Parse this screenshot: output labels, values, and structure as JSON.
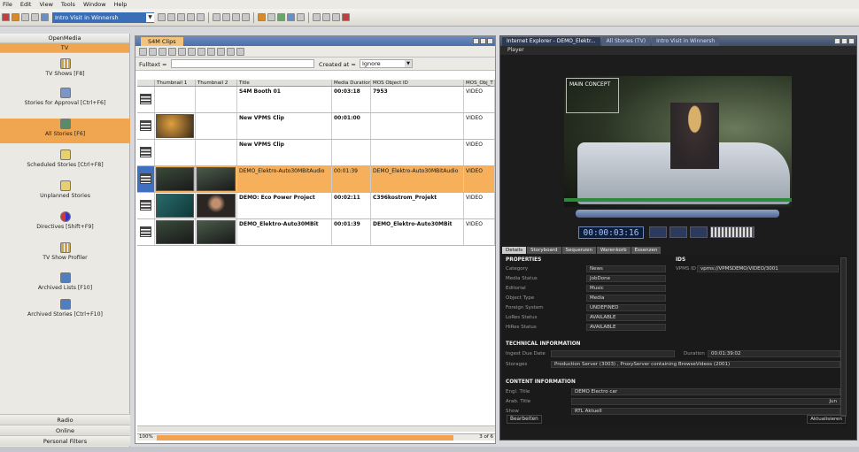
{
  "menubar": {
    "items": [
      "File",
      "Edit",
      "View",
      "Tools",
      "Window",
      "Help"
    ]
  },
  "toolbar": {
    "window_select": "Intro Visit in Winnersh"
  },
  "sidebar": {
    "header": "OpenMedia",
    "section": "TV",
    "items": [
      {
        "label": "TV Shows [F8]",
        "icon": "grid-icon"
      },
      {
        "label": "Stories for Approval [Ctrl+F6]",
        "icon": "story-icon"
      },
      {
        "label": "All Stories [F6]",
        "icon": "stories-icon",
        "selected": true
      },
      {
        "label": "Scheduled Stories [Ctrl+F8]",
        "icon": "scheduled-icon"
      },
      {
        "label": "Unplanned Stories",
        "icon": "unplanned-icon"
      },
      {
        "label": "Directives [Shift+F9]",
        "icon": "directives-icon"
      },
      {
        "label": "TV Show Profiler",
        "icon": "profiler-icon"
      },
      {
        "label": "Archived Lists [F10]",
        "icon": "archive-icon"
      },
      {
        "label": "Archived Stories [Ctrl+F10]",
        "icon": "archive-icon"
      }
    ],
    "footer": [
      "Radio",
      "Online",
      "Personal Filters"
    ]
  },
  "clips": {
    "tab": "S4M Clips",
    "fulltext_label": "Fulltext =",
    "created_label": "Created at =",
    "created_value": "Ignore",
    "columns": [
      "Thumbnail 1",
      "Thumbnail 2",
      "Title",
      "Media Duration",
      "MOS Object ID",
      "MOS_Obj_T"
    ],
    "rows": [
      {
        "title": "S4M Booth 01",
        "duration": "00:03:18",
        "mos_id": "7953",
        "type": "VIDEO",
        "thumbs": 0
      },
      {
        "title": "New VPMS Clip",
        "duration": "00:01:00",
        "mos_id": "",
        "type": "VIDEO",
        "thumbs": 1
      },
      {
        "title": "New VPMS Clip",
        "duration": "",
        "mos_id": "",
        "type": "VIDEO",
        "thumbs": 0
      },
      {
        "title": "DEMO_Elektro-Auto30MBitAudio",
        "duration": "00:01:39",
        "mos_id": "DEMO_Elektro-Auto30MBitAudio",
        "type": "VIDEO",
        "thumbs": 2,
        "selected": true
      },
      {
        "title": "DEMO: Eco Power Project",
        "duration": "00:02:11",
        "mos_id": "C396kostrom_Projekt",
        "type": "VIDEO",
        "thumbs": 2
      },
      {
        "title": "DEMO_Elektro-Auto30MBit",
        "duration": "00:01:39",
        "mos_id": "DEMO_Elektro-Auto30MBit",
        "type": "VIDEO",
        "thumbs": 2
      }
    ],
    "status_pct": "100%",
    "status_count": "3 of 6"
  },
  "right": {
    "tabs": [
      "Internet Explorer - DEMO_Elektr...",
      "All Stories (TV)",
      "Intro Visit in Winnersh"
    ],
    "player_title": "Player",
    "video_logo": "MAIN CONCEPT",
    "timecode": "00:00:03:16",
    "detail_tabs": [
      "Details",
      "Storyboard",
      "Sequenzen",
      "Warenkorb",
      "Essenzen"
    ],
    "properties_header": "PROPERTIES",
    "ids_header": "IDS",
    "vpms_id_label": "VPMS ID",
    "vpms_id_value": "vpms://VPMSDEMO/VIDEO/3001",
    "properties": [
      {
        "label": "Category",
        "value": "News"
      },
      {
        "label": "Media Status",
        "value": "JobDone"
      },
      {
        "label": "Editorial",
        "value": "Music"
      },
      {
        "label": "Object Type",
        "value": "Media"
      },
      {
        "label": "Foreign System",
        "value": "UNDEFINED"
      },
      {
        "label": "LoRes Status",
        "value": "AVAILABLE"
      },
      {
        "label": "HiRes Status",
        "value": "AVAILABLE"
      }
    ],
    "technical_header": "TECHNICAL INFORMATION",
    "ingest_label": "Ingest Due Date",
    "duration_label": "Duration",
    "duration_value": "00:01:39:02",
    "storages_label": "Storages",
    "storages_value": "Production Server (3003) , ProxyServer containing BrowseVideos (2001)",
    "content_header": "CONTENT INFORMATION",
    "engl_title_label": "Engl. Title",
    "engl_title_value": "DEMO Electro car",
    "arab_title_label": "Arab. Title",
    "arab_title_value": "",
    "arab_suffix": "Jun",
    "show_label": "Show",
    "show_value": "RTL Aktuell",
    "edit_button": "Bearbeiten",
    "refresh_button": "Aktualisieren"
  }
}
